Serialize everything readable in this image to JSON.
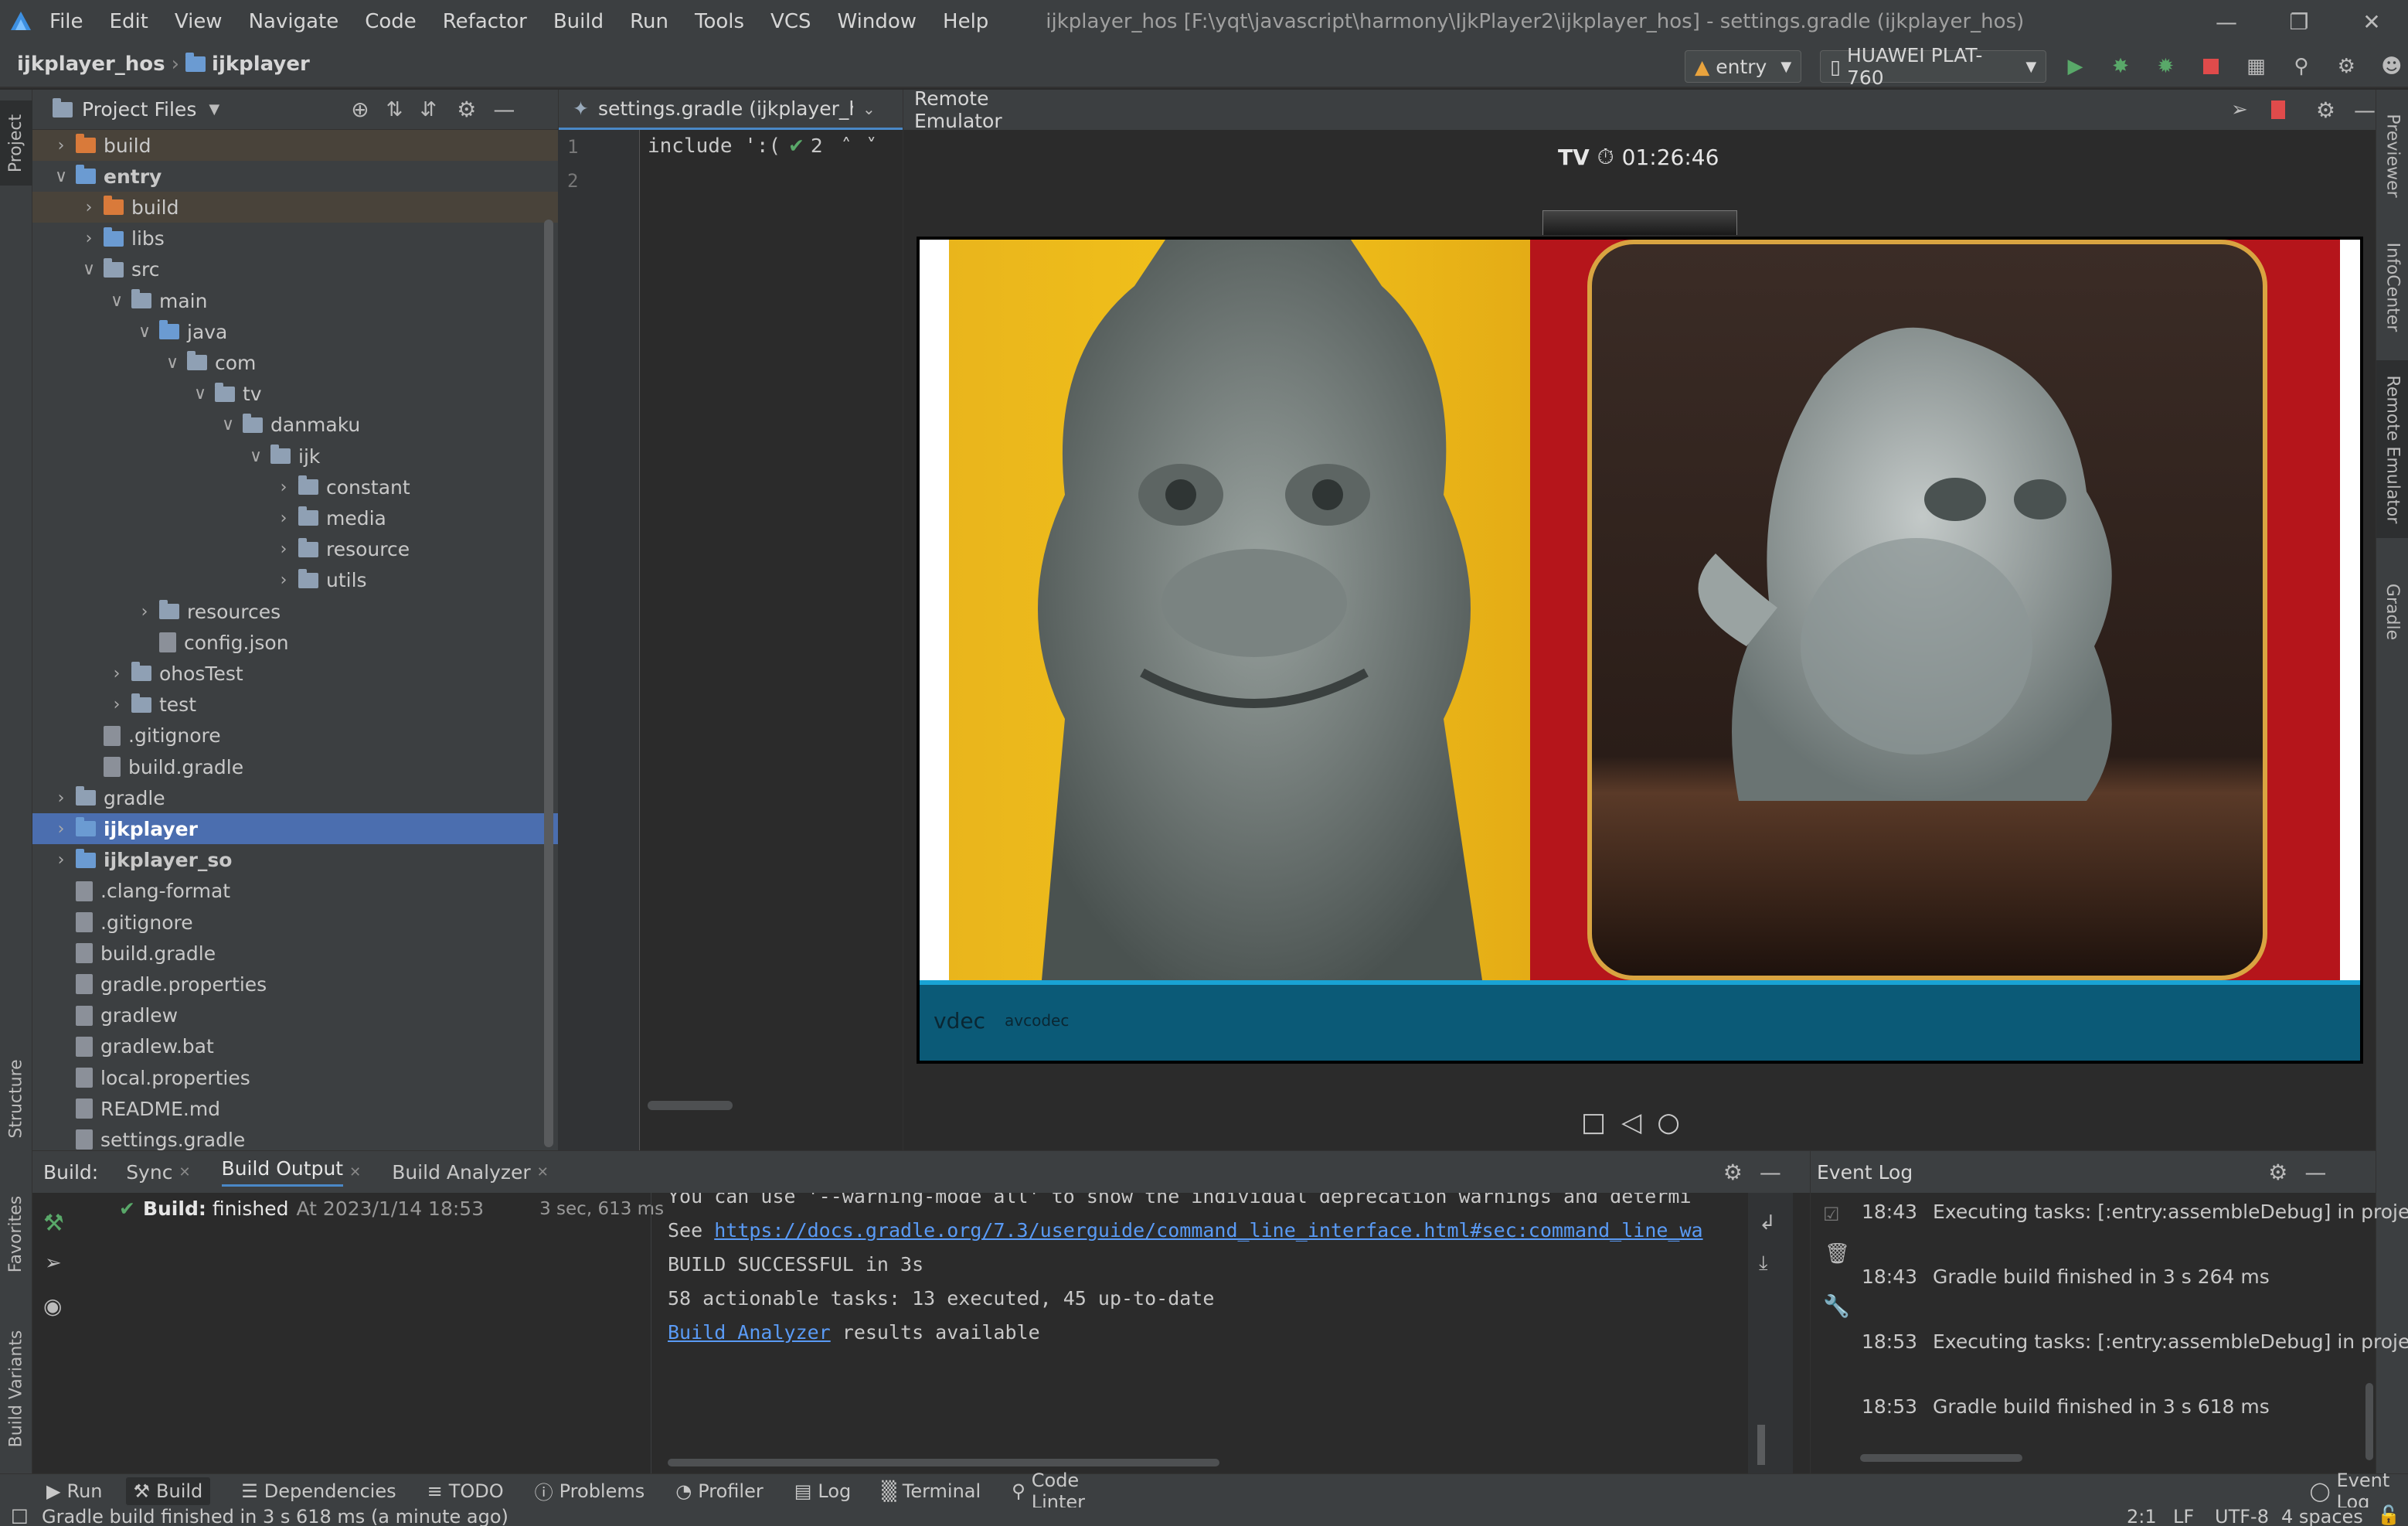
{
  "menubar": {
    "items": [
      "File",
      "Edit",
      "View",
      "Navigate",
      "Code",
      "Refactor",
      "Build",
      "Run",
      "Tools",
      "VCS",
      "Window",
      "Help"
    ],
    "title": "ijkplayer_hos [F:\\yqt\\javascript\\harmony\\IjkPlayer2\\ijkplayer_hos] - settings.gradle (ijkplayer_hos)"
  },
  "breadcrumb": {
    "root": "ijkplayer_hos",
    "child": "ijkplayer"
  },
  "toolbar": {
    "run_config": "entry",
    "device": "HUAWEI PLAT-760"
  },
  "left_strip": {
    "project": "Project",
    "structure": "Structure",
    "favorites": "Favorites",
    "build_variants": "Build Variants"
  },
  "right_strip": {
    "previewer": "Previewer",
    "infocenter": "InfoCenter",
    "remote_emulator": "Remote Emulator",
    "gradle": "Gradle"
  },
  "project": {
    "header": "Project Files",
    "tree": [
      {
        "name": "build",
        "icon": "folder-orange",
        "depth": 1,
        "chev": "right",
        "excl": true
      },
      {
        "name": "entry",
        "icon": "folder-blue",
        "depth": 1,
        "chev": "down",
        "bold": true
      },
      {
        "name": "build",
        "icon": "folder-orange",
        "depth": 2,
        "chev": "right",
        "excl": true
      },
      {
        "name": "libs",
        "icon": "folder-blue",
        "depth": 2,
        "chev": "right"
      },
      {
        "name": "src",
        "icon": "folder-grey",
        "depth": 2,
        "chev": "down"
      },
      {
        "name": "main",
        "icon": "folder-grey",
        "depth": 3,
        "chev": "down"
      },
      {
        "name": "java",
        "icon": "folder-blue",
        "depth": 4,
        "chev": "down"
      },
      {
        "name": "com",
        "icon": "folder-grey",
        "depth": 5,
        "chev": "down"
      },
      {
        "name": "tv",
        "icon": "folder-grey",
        "depth": 6,
        "chev": "down"
      },
      {
        "name": "danmaku",
        "icon": "folder-grey",
        "depth": 7,
        "chev": "down"
      },
      {
        "name": "ijk",
        "icon": "folder-grey",
        "depth": 8,
        "chev": "down"
      },
      {
        "name": "constant",
        "icon": "folder-grey",
        "depth": 9,
        "chev": "right"
      },
      {
        "name": "media",
        "icon": "folder-grey",
        "depth": 9,
        "chev": "right"
      },
      {
        "name": "resource",
        "icon": "folder-grey",
        "depth": 9,
        "chev": "right"
      },
      {
        "name": "utils",
        "icon": "folder-grey",
        "depth": 9,
        "chev": "right"
      },
      {
        "name": "resources",
        "icon": "folder-grey",
        "depth": 4,
        "chev": "right"
      },
      {
        "name": "config.json",
        "icon": "file",
        "depth": 4,
        "chev": "none"
      },
      {
        "name": "ohosTest",
        "icon": "folder-grey",
        "depth": 3,
        "chev": "right"
      },
      {
        "name": "test",
        "icon": "folder-grey",
        "depth": 3,
        "chev": "right"
      },
      {
        "name": ".gitignore",
        "icon": "file",
        "depth": 2,
        "chev": "none"
      },
      {
        "name": "build.gradle",
        "icon": "file",
        "depth": 2,
        "chev": "none"
      },
      {
        "name": "gradle",
        "icon": "folder-grey",
        "depth": 1,
        "chev": "right"
      },
      {
        "name": "ijkplayer",
        "icon": "folder-blue",
        "depth": 1,
        "chev": "right",
        "bold": true,
        "sel": true
      },
      {
        "name": "ijkplayer_so",
        "icon": "folder-blue",
        "depth": 1,
        "chev": "right",
        "bold": true
      },
      {
        "name": ".clang-format",
        "icon": "file",
        "depth": 1,
        "chev": "none"
      },
      {
        "name": ".gitignore",
        "icon": "file",
        "depth": 1,
        "chev": "none"
      },
      {
        "name": "build.gradle",
        "icon": "file",
        "depth": 1,
        "chev": "none"
      },
      {
        "name": "gradle.properties",
        "icon": "file",
        "depth": 1,
        "chev": "none"
      },
      {
        "name": "gradlew",
        "icon": "file",
        "depth": 1,
        "chev": "none"
      },
      {
        "name": "gradlew.bat",
        "icon": "file",
        "depth": 1,
        "chev": "none"
      },
      {
        "name": "local.properties",
        "icon": "file",
        "depth": 1,
        "chev": "none"
      },
      {
        "name": "README.md",
        "icon": "file",
        "depth": 1,
        "chev": "none"
      },
      {
        "name": "settings.gradle",
        "icon": "file",
        "depth": 1,
        "chev": "none"
      }
    ]
  },
  "editor": {
    "tab": "settings.gradle (ijkplayer_ho",
    "line1": "1",
    "line2": "2",
    "code": "include ':(",
    "check_count": "2"
  },
  "emulator": {
    "header": "Remote Emulator",
    "device": "TV",
    "time": "01:26:46",
    "vdec_label": "vdec",
    "codec_label": "avcodec"
  },
  "build": {
    "tabs": {
      "label": "Build:",
      "sync": "Sync",
      "output": "Build Output",
      "analyzer": "Build Analyzer"
    },
    "status_bold": "Build:",
    "status_text": "finished",
    "status_time": "At 2023/1/14 18:53",
    "duration": "3 sec, 613 ms",
    "console": {
      "line0": "You can use '--warning-mode all' to show the individual deprecation warnings and determi",
      "see": "See ",
      "url": "https://docs.gradle.org/7.3/userguide/command_line_interface.html#sec:command_line_wa",
      "success": "BUILD SUCCESSFUL in 3s",
      "tasks": "58 actionable tasks: 13 executed, 45 up-to-date",
      "analyzer_link": "Build Analyzer",
      "analyzer_text": " results available"
    }
  },
  "eventlog": {
    "header": "Event Log",
    "entries": [
      {
        "time": "18:43",
        "text": "Executing tasks: [:entry:assembleDebug] in project F"
      },
      {
        "time": "18:43",
        "text": "Gradle build finished in 3 s 264 ms"
      },
      {
        "time": "18:53",
        "text": "Executing tasks: [:entry:assembleDebug] in project F"
      },
      {
        "time": "18:53",
        "text": "Gradle build finished in 3 s 618 ms"
      }
    ]
  },
  "bottom_tools": [
    "Run",
    "Build",
    "Dependencies",
    "TODO",
    "Problems",
    "Profiler",
    "Log",
    "Terminal",
    "Code Linter"
  ],
  "event_log_button": "Event Log",
  "status": {
    "message": "Gradle build finished in 3 s 618 ms (a minute ago)",
    "position": "2:1",
    "line_sep": "LF",
    "encoding": "UTF-8",
    "indent": "4 spaces"
  },
  "colors": {
    "accent": "#4b6eaf",
    "link": "#5a9bf6",
    "success": "#59a869",
    "stop": "#e04b4b",
    "video_bar": "#0b5a77"
  }
}
